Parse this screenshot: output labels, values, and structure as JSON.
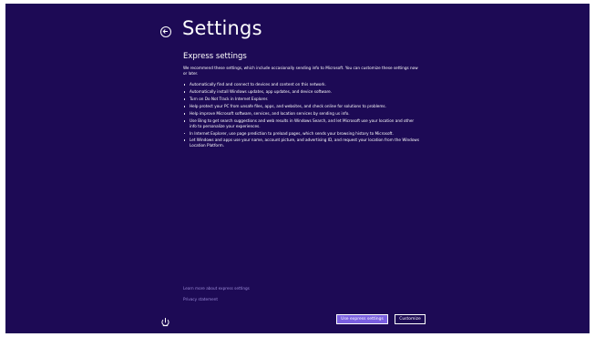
{
  "header": {
    "back_icon": "back-arrow-circle-icon",
    "title": "Settings"
  },
  "section": {
    "title": "Express settings",
    "intro": "We recommend these settings, which include occasionally sending info to Microsoft. You can customize these settings now or later."
  },
  "bullets": [
    "Automatically find and connect to devices and content on this network.",
    "Automatically install Windows updates, app updates, and device software.",
    "Turn on Do Not Track in Internet Explorer.",
    "Help protect your PC from unsafe files, apps, and websites, and check online for solutions to problems.",
    "Help improve Microsoft software, services, and location services by sending us info.",
    "Use Bing to get search suggestions and web results in Windows Search, and let Microsoft use your location and other info to personalize your experiences.",
    "In Internet Explorer, use page prediction to preload pages, which sends your browsing history to Microsoft.",
    "Let Windows and apps use your name, account picture, and advertising ID, and request your location from the Windows Location Platform."
  ],
  "links": {
    "learn_more": "Learn more about express settings",
    "privacy": "Privacy statement"
  },
  "footer": {
    "ease_icon": "ease-of-access-icon",
    "express_button": "Use express settings",
    "customize_button": "Customize"
  },
  "colors": {
    "background": "#1d0a55",
    "accent": "#7a5fe0",
    "link": "#9b8bd8",
    "text": "#ffffff"
  }
}
